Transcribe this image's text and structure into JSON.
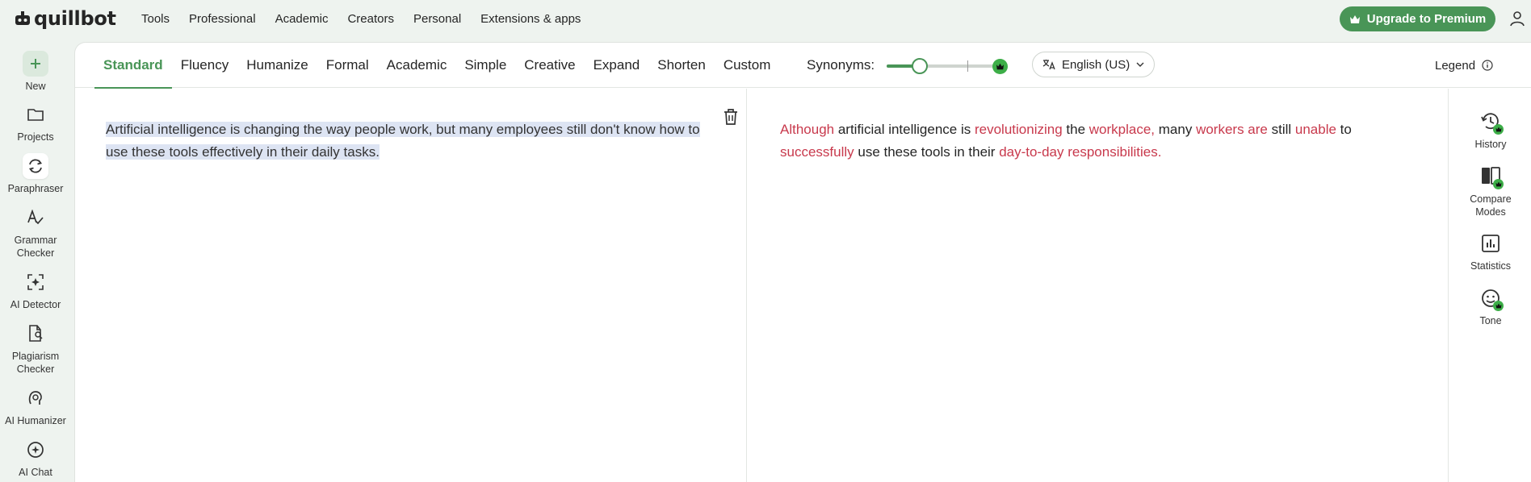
{
  "brand": {
    "name": "quillbot"
  },
  "topnav": {
    "items": [
      "Tools",
      "Professional",
      "Academic",
      "Creators",
      "Personal",
      "Extensions & apps"
    ],
    "premium_label": "Upgrade to Premium"
  },
  "sidebar": {
    "items": [
      {
        "label": "New",
        "icon": "plus-icon"
      },
      {
        "label": "Projects",
        "icon": "folder-icon"
      },
      {
        "label": "Paraphraser",
        "icon": "paraphraser-icon",
        "active": true
      },
      {
        "label": "Grammar Checker",
        "icon": "grammar-icon"
      },
      {
        "label": "AI Detector",
        "icon": "ai-detector-icon"
      },
      {
        "label": "Plagiarism Checker",
        "icon": "plagiarism-icon"
      },
      {
        "label": "AI Humanizer",
        "icon": "humanizer-icon"
      },
      {
        "label": "AI Chat",
        "icon": "ai-chat-icon"
      }
    ]
  },
  "modes": {
    "tabs": [
      "Standard",
      "Fluency",
      "Humanize",
      "Formal",
      "Academic",
      "Simple",
      "Creative",
      "Expand",
      "Shorten",
      "Custom"
    ],
    "active": "Standard",
    "synonyms_label": "Synonyms:",
    "synonyms_level": 0.29,
    "language": "English (US)",
    "legend_label": "Legend"
  },
  "input": {
    "text": "Artificial intelligence is changing the way people work, but many employees still don't know how to use these tools effectively in their daily tasks."
  },
  "output": {
    "segments": [
      {
        "t": "Although",
        "changed": true
      },
      {
        "t": " artificial intelligence is ",
        "changed": false
      },
      {
        "t": "revolutionizing",
        "changed": true
      },
      {
        "t": " the ",
        "changed": false
      },
      {
        "t": "workplace,",
        "changed": true
      },
      {
        "t": " many ",
        "changed": false
      },
      {
        "t": "workers are",
        "changed": true
      },
      {
        "t": " still ",
        "changed": false
      },
      {
        "t": "unable",
        "changed": true
      },
      {
        "t": " to ",
        "changed": false
      },
      {
        "t": "successfully",
        "changed": true
      },
      {
        "t": " use these tools in their ",
        "changed": false
      },
      {
        "t": "day-to-day responsibilities.",
        "changed": true
      }
    ]
  },
  "right_rail": {
    "items": [
      {
        "label": "History",
        "icon": "history-icon"
      },
      {
        "label": "Compare Modes",
        "icon": "compare-icon"
      },
      {
        "label": "Statistics",
        "icon": "statistics-icon"
      },
      {
        "label": "Tone",
        "icon": "tone-icon"
      }
    ]
  },
  "colors": {
    "brand_green": "#499557",
    "changed_text": "#c8394c",
    "input_highlight": "#dde4f3"
  }
}
